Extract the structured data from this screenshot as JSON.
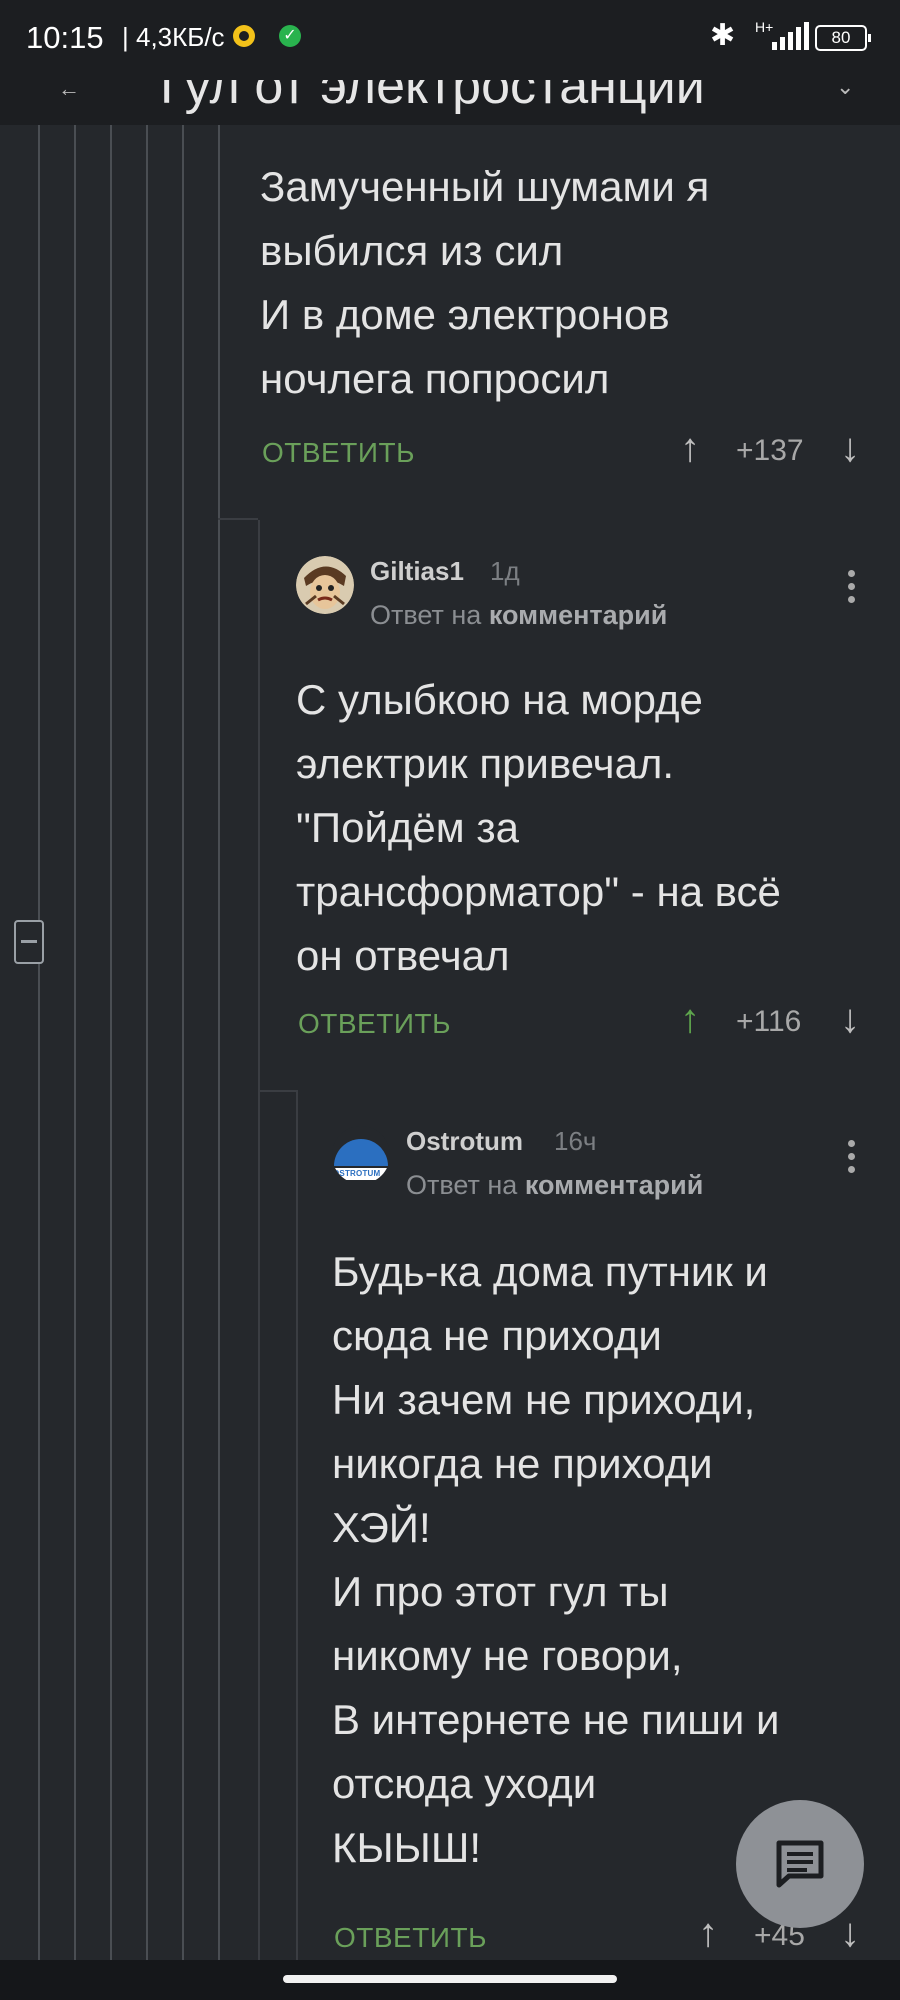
{
  "status_bar": {
    "time": "10:15",
    "network_speed": "| 4,3КБ/с",
    "battery": "80",
    "signal_label": "H+"
  },
  "header": {
    "title": "Гул от электростанции"
  },
  "comments": [
    {
      "text_lines": [
        "Замученный шумами я",
        "выбился из сил",
        "И в доме электронов",
        "ночлега попросил"
      ],
      "reply_label": "ОТВЕТИТЬ",
      "votes": "+137",
      "upvoted": false
    },
    {
      "author": "Giltias1",
      "age": "1д",
      "reply_to_prefix": "Ответ на",
      "reply_to_link": "комментарий",
      "text_lines": [
        "С улыбкою на морде",
        "электрик привечал.",
        "\"Пойдём за",
        "трансформатор\" - на всё",
        "он отвечал"
      ],
      "reply_label": "ОТВЕТИТЬ",
      "votes": "+116",
      "upvoted": true
    },
    {
      "author": "Ostrotum",
      "age": "16ч",
      "reply_to_prefix": "Ответ на",
      "reply_to_link": "комментарий",
      "avatar_text": "OSTROTUM",
      "text_lines": [
        "Будь-ка дома путник и",
        "сюда не приходи",
        "Ни зачем не приходи,",
        "никогда не приходи",
        "ХЭЙ!",
        "И про этот гул ты",
        "никому не говори,",
        "В интернете не пиши и",
        "отсюда уходи",
        "КЫЫШ!"
      ],
      "reply_label": "ОТВЕТИТЬ",
      "votes": "+45",
      "upvoted": false
    }
  ],
  "colors": {
    "background": "#25282c",
    "reply_green": "#6aa05a",
    "upvote_green": "#5ea54d",
    "fab": "#8e9196"
  },
  "icons": [
    "back-icon",
    "chevron-down-icon",
    "bluetooth-icon",
    "signal-icon",
    "battery-icon",
    "collapse-icon",
    "kebab-menu-icon",
    "upvote-icon",
    "downvote-icon",
    "comment-fab-icon"
  ]
}
